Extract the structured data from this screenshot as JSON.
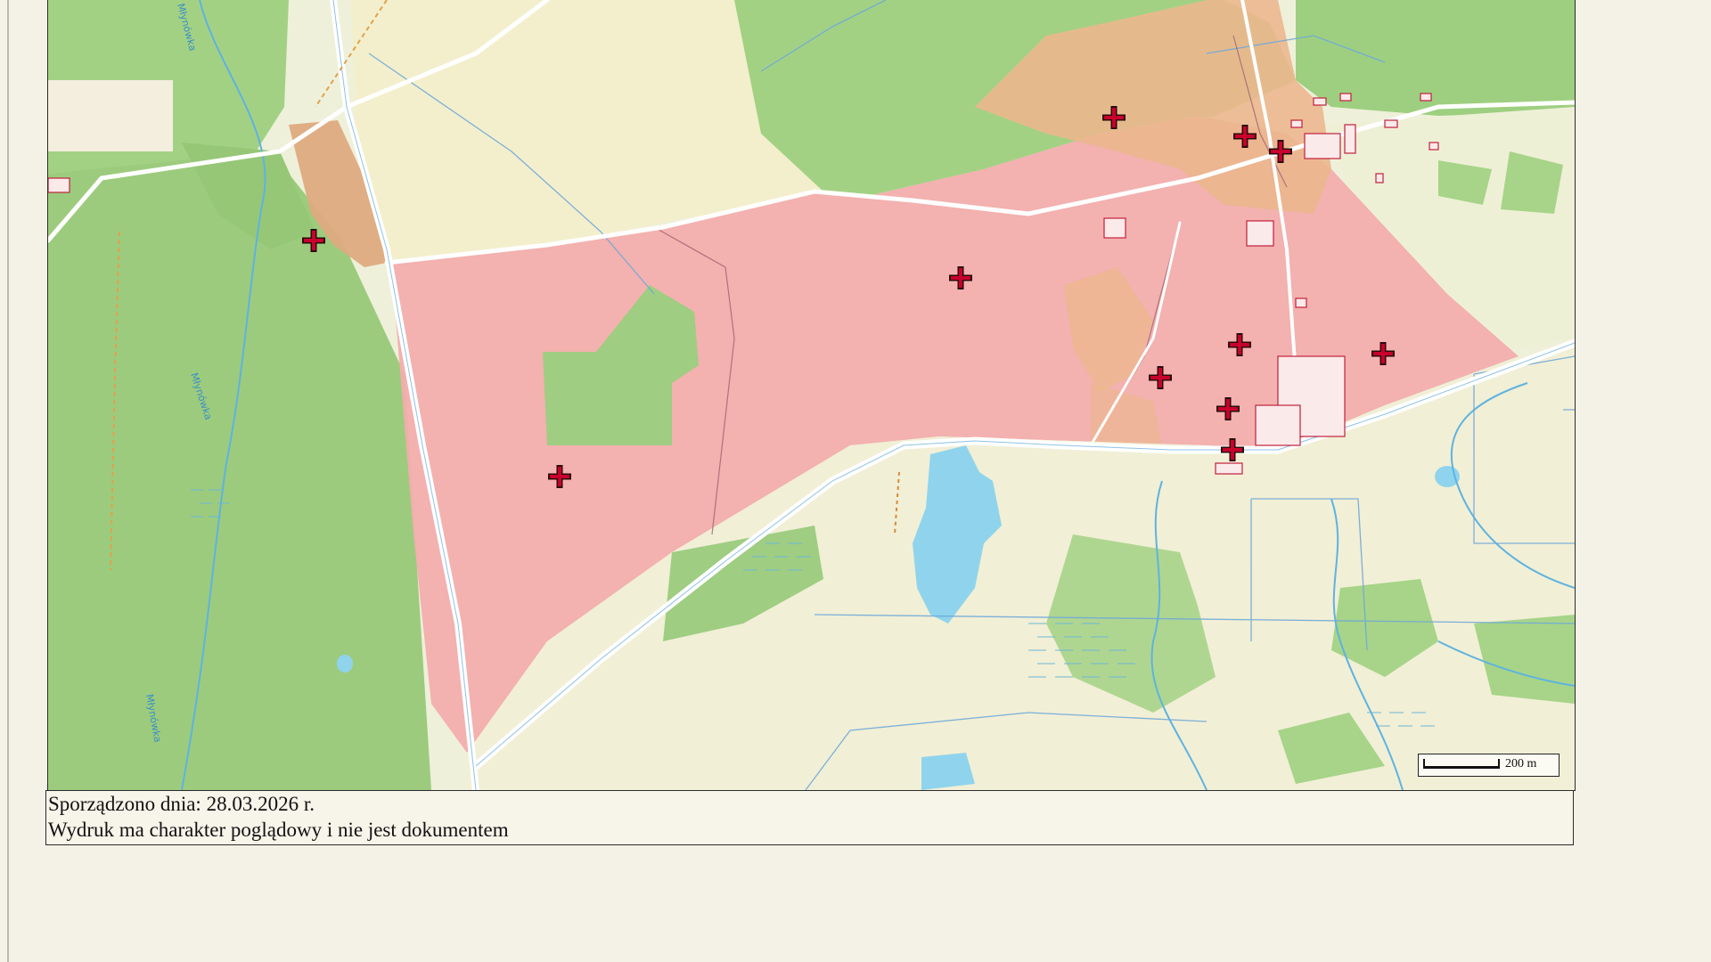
{
  "document": {
    "caption_date_line": "Sporządzono dnia: 28.03.2026 r.",
    "caption_note_line": "Wydruk ma charakter poglądowy i nie jest dokumentem"
  },
  "map": {
    "scale_label": "200 m",
    "stream_label": "Młynówka",
    "colors": {
      "forest": "#9ccf7f",
      "meadow": "#f1ecc7",
      "field": "#eef2dc",
      "parcel_pink": "#f2aeae",
      "parcel_orange": "#e8b487",
      "water": "#8ed3ea",
      "road": "#ffffff",
      "marker": "#b00024"
    },
    "markers": [
      {
        "name": "marker-nw-parcel"
      },
      {
        "name": "marker-west-parcel"
      },
      {
        "name": "marker-central"
      },
      {
        "name": "marker-north"
      },
      {
        "name": "marker-northeast-a"
      },
      {
        "name": "marker-northeast-b"
      },
      {
        "name": "marker-east-a"
      },
      {
        "name": "marker-east-b"
      },
      {
        "name": "marker-village-a"
      },
      {
        "name": "marker-village-b"
      },
      {
        "name": "marker-village-c"
      }
    ]
  }
}
